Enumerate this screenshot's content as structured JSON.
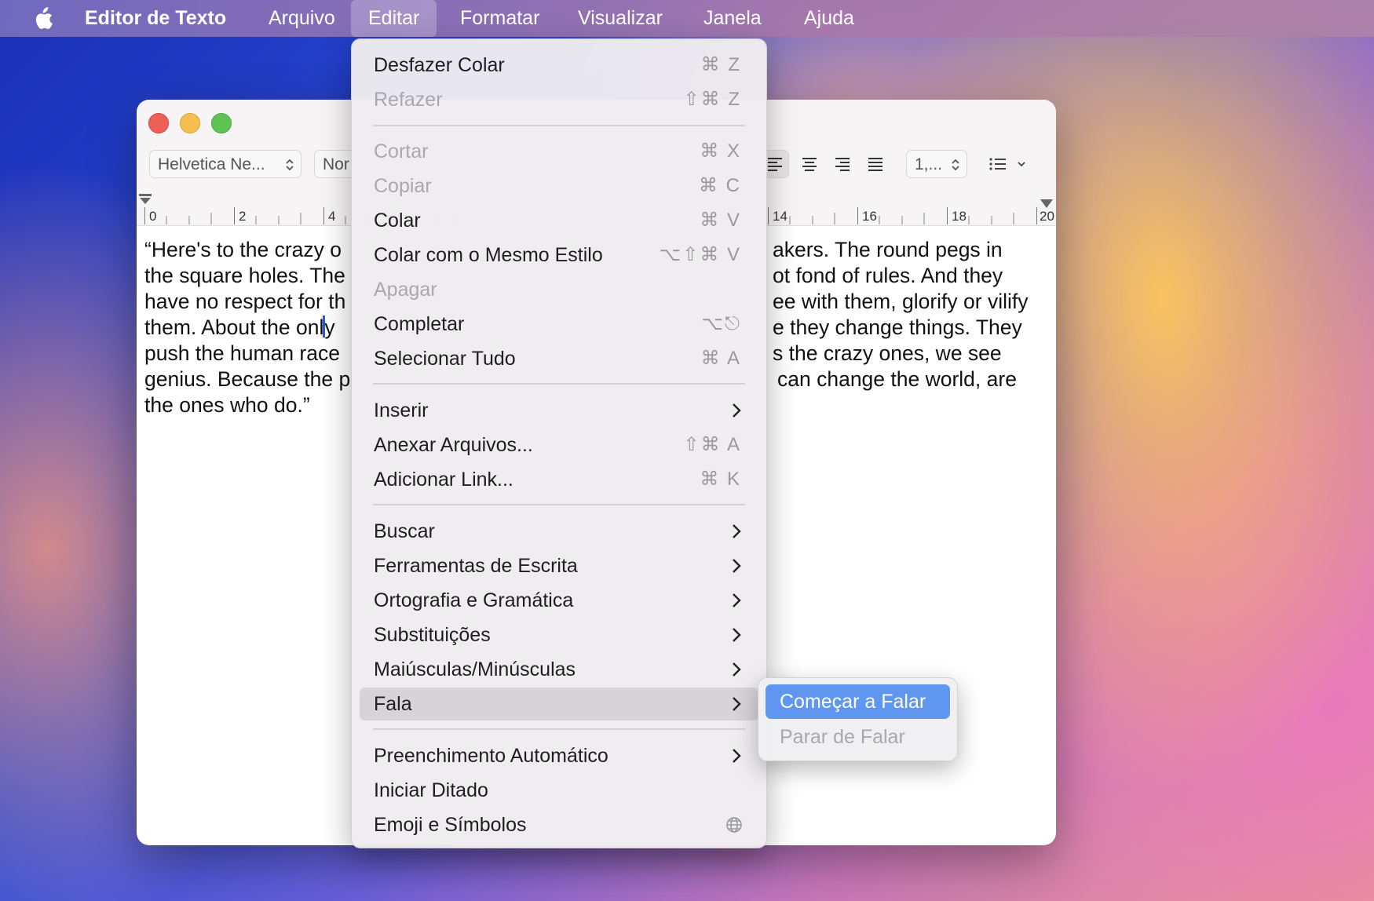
{
  "menubar": {
    "app_name": "Editor de Texto",
    "menus": [
      "Arquivo",
      "Editar",
      "Formatar",
      "Visualizar",
      "Janela",
      "Ajuda"
    ],
    "active_menu": "Editar"
  },
  "toolbar": {
    "font_family": "Helvetica Ne...",
    "font_style": "Nor",
    "line_spacing": "1,..."
  },
  "ruler": {
    "labels": [
      "0",
      "2",
      "4",
      "14",
      "16",
      "18",
      "20"
    ]
  },
  "document": {
    "lines": [
      "“Here's to the crazy o",
      "the square holes. The",
      "have no respect for th",
      "them. About the onl",
      "push the human race",
      "genius. Because the p",
      "the ones who do.”"
    ],
    "caret_line_rest": "y",
    "right_lines": [
      "akers. The round pegs in",
      "ot fond of rules. And they",
      "ee with them, glorify or vilify",
      "e they change things. They",
      "s the crazy ones, we see",
      "can change the world, are"
    ]
  },
  "edit_menu": {
    "items": [
      {
        "label": "Desfazer Colar",
        "shortcut": "⌘ Z",
        "enabled": true
      },
      {
        "label": "Refazer",
        "shortcut": "⇧⌘ Z",
        "enabled": false
      },
      {
        "label": "Cortar",
        "shortcut": "⌘ X",
        "enabled": false
      },
      {
        "label": "Copiar",
        "shortcut": "⌘ C",
        "enabled": false
      },
      {
        "label": "Colar",
        "shortcut": "⌘ V",
        "enabled": true
      },
      {
        "label": "Colar com o Mesmo Estilo",
        "shortcut": "⌥⇧⌘ V",
        "enabled": true
      },
      {
        "label": "Apagar",
        "shortcut": "",
        "enabled": false
      },
      {
        "label": "Completar",
        "shortcut": "⌥⎋",
        "enabled": true
      },
      {
        "label": "Selecionar Tudo",
        "shortcut": "⌘ A",
        "enabled": true
      },
      {
        "label": "Inserir",
        "submenu": true,
        "enabled": true
      },
      {
        "label": "Anexar Arquivos...",
        "shortcut": "⇧⌘ A",
        "enabled": true
      },
      {
        "label": "Adicionar Link...",
        "shortcut": "⌘ K",
        "enabled": true
      },
      {
        "label": "Buscar",
        "submenu": true,
        "enabled": true
      },
      {
        "label": "Ferramentas de Escrita",
        "submenu": true,
        "enabled": true
      },
      {
        "label": "Ortografia e Gramática",
        "submenu": true,
        "enabled": true
      },
      {
        "label": "Substituições",
        "submenu": true,
        "enabled": true
      },
      {
        "label": "Maiúsculas/Minúsculas",
        "submenu": true,
        "enabled": true
      },
      {
        "label": "Fala",
        "submenu": true,
        "enabled": true,
        "highlighted": true
      },
      {
        "label": "Preenchimento Automático",
        "submenu": true,
        "enabled": true
      },
      {
        "label": "Iniciar Ditado",
        "shortcut": "",
        "enabled": true
      },
      {
        "label": "Emoji e Símbolos",
        "shortcut": "globe-icon",
        "enabled": true
      }
    ]
  },
  "speech_submenu": {
    "items": [
      {
        "label": "Começar a Falar",
        "selected": true,
        "enabled": true
      },
      {
        "label": "Parar de Falar",
        "enabled": false
      }
    ]
  }
}
